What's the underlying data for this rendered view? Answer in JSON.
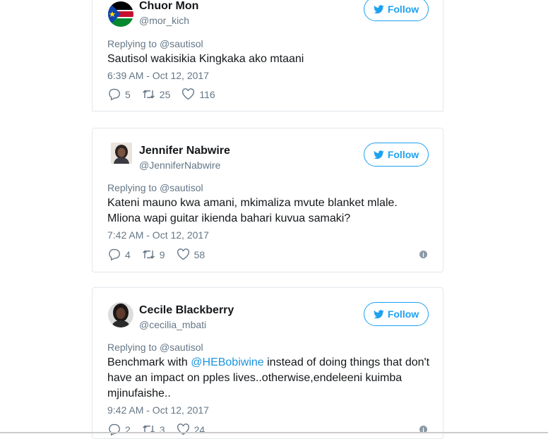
{
  "follow_label": "Follow",
  "tweets": [
    {
      "name": "Chuor Mon",
      "handle": "@mor_kich",
      "replying_prefix": "Replying to",
      "replying_to": "@sautisol",
      "text": "Sautisol wakisikia Kingkaka ako mtaani",
      "time": "6:39 AM - Oct 12, 2017",
      "replies": "5",
      "retweets": "25",
      "likes": "116"
    },
    {
      "name": "Jennifer Nabwire",
      "handle": "@JenniferNabwire",
      "replying_prefix": "Replying to",
      "replying_to": "@sautisol",
      "text_line1": "Kateni mauno kwa amani, mkimaliza mvute blanket mlale.",
      "text_line2": "Mliona wapi guitar ikienda bahari kuvua samaki?",
      "time": "7:42 AM - Oct 12, 2017",
      "replies": "4",
      "retweets": "9",
      "likes": "58"
    },
    {
      "name": "Cecile Blackberry",
      "handle": "@cecilia_mbati",
      "replying_prefix": "Replying to",
      "replying_to": "@sautisol",
      "text_prefix": "Benchmark with ",
      "mention": "@HEBobiwine",
      "text_suffix": " instead of doing things that don't have an impact on pples lives..otherwise,endeleeni kuimba mjinufaishe..",
      "time": "9:42 AM - Oct 12, 2017",
      "replies": "2",
      "retweets": "3",
      "likes": "24"
    }
  ],
  "colors": {
    "accent": "#1da1f2",
    "secondary_text": "#657786",
    "border": "#e1e8ed"
  },
  "icons": [
    "twitter-bird-icon",
    "reply-icon",
    "retweet-icon",
    "like-icon",
    "info-icon",
    "flag-avatar",
    "avatar"
  ]
}
